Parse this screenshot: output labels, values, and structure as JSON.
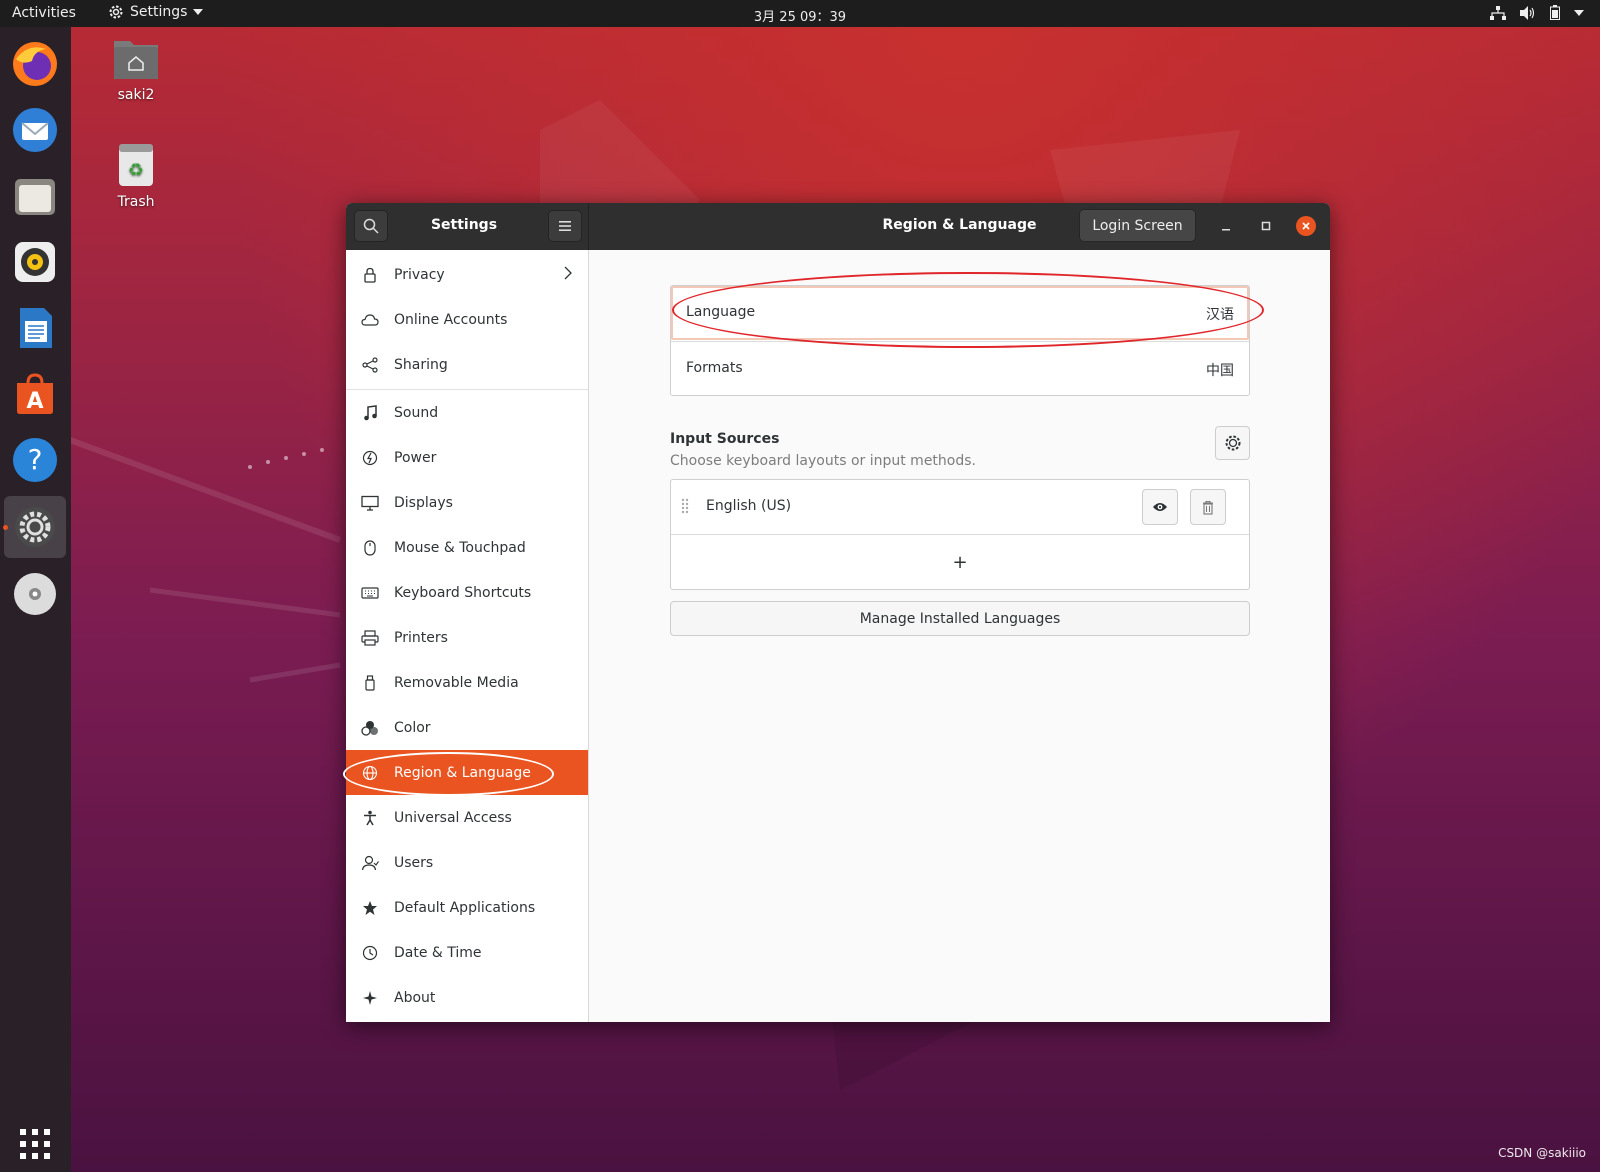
{
  "topbar": {
    "activities": "Activities",
    "app_menu": "Settings",
    "clock": "3月 25  09：39"
  },
  "desktop": {
    "icons": [
      {
        "label": "saki2",
        "icon": "home-folder-icon"
      },
      {
        "label": "Trash",
        "icon": "trash-icon"
      }
    ]
  },
  "dock": {
    "items": [
      "firefox",
      "thunderbird",
      "files",
      "rhythmbox",
      "libreoffice-writer",
      "ubuntu-software",
      "help",
      "settings",
      "dvd-drive"
    ],
    "active": "settings"
  },
  "window": {
    "sidebar_title": "Settings",
    "panel_title": "Region & Language",
    "login_screen_label": "Login Screen"
  },
  "sidebar": {
    "items": [
      {
        "label": "Privacy",
        "icon": "lock-icon"
      },
      {
        "label": "Online Accounts",
        "icon": "cloud-icon"
      },
      {
        "label": "Sharing",
        "icon": "share-icon"
      },
      {
        "label": "Sound",
        "icon": "music-note-icon"
      },
      {
        "label": "Power",
        "icon": "power-icon"
      },
      {
        "label": "Displays",
        "icon": "display-icon"
      },
      {
        "label": "Mouse & Touchpad",
        "icon": "mouse-icon"
      },
      {
        "label": "Keyboard Shortcuts",
        "icon": "keyboard-icon"
      },
      {
        "label": "Printers",
        "icon": "printer-icon"
      },
      {
        "label": "Removable Media",
        "icon": "usb-icon"
      },
      {
        "label": "Color",
        "icon": "color-icon"
      },
      {
        "label": "Region & Language",
        "icon": "globe-icon"
      },
      {
        "label": "Universal Access",
        "icon": "accessibility-icon"
      },
      {
        "label": "Users",
        "icon": "users-icon"
      },
      {
        "label": "Default Applications",
        "icon": "star-icon"
      },
      {
        "label": "Date & Time",
        "icon": "clock-icon"
      },
      {
        "label": "About",
        "icon": "about-icon"
      }
    ],
    "selected": "Region & Language"
  },
  "main": {
    "language_label": "Language",
    "language_value": "汉语",
    "formats_label": "Formats",
    "formats_value": "中国",
    "input_sources_title": "Input Sources",
    "input_sources_desc": "Choose keyboard layouts or input methods.",
    "input_sources": [
      "English (US)"
    ],
    "add_symbol": "+",
    "manage_languages_label": "Manage Installed Languages"
  },
  "colors": {
    "accent": "#e95420",
    "annotation": "#e0262a"
  },
  "watermark": "CSDN @sakiiio"
}
